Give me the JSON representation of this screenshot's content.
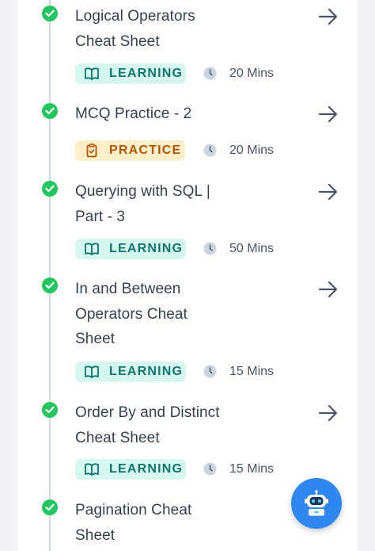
{
  "items": [
    {
      "title_lines": [
        "Logical Operators",
        "Cheat Sheet"
      ],
      "badge": "LEARNING",
      "duration": "20 Mins",
      "completed": true,
      "badge_icon": "book-icon"
    },
    {
      "title_lines": [
        "MCQ Practice - 2"
      ],
      "badge": "PRACTICE",
      "duration": "20 Mins",
      "completed": true,
      "badge_icon": "clipboard-icon"
    },
    {
      "title_lines": [
        "Querying with SQL |",
        "Part - 3"
      ],
      "badge": "LEARNING",
      "duration": "50 Mins",
      "completed": true,
      "badge_icon": "book-icon"
    },
    {
      "title_lines": [
        "In and Between",
        "Operators Cheat",
        "Sheet"
      ],
      "badge": "LEARNING",
      "duration": "15 Mins",
      "completed": true,
      "badge_icon": "book-icon"
    },
    {
      "title_lines": [
        "Order By and Distinct",
        "Cheat Sheet"
      ],
      "badge": "LEARNING",
      "duration": "15 Mins",
      "completed": true,
      "badge_icon": "book-icon"
    },
    {
      "title_lines": [
        "Pagination Cheat",
        "Sheet"
      ],
      "completed": true
    }
  ],
  "icons": {
    "check": "check-icon",
    "arrow": "arrow-right-icon",
    "clock": "clock-icon",
    "assistant": "robot-icon"
  },
  "colors": {
    "check_green": "#22c55e",
    "learning_bg": "#d5f7f0",
    "learning_text": "#0f766e",
    "practice_bg": "#fdefc7",
    "practice_text": "#b45309",
    "assistant_blue": "#2f87f0"
  }
}
